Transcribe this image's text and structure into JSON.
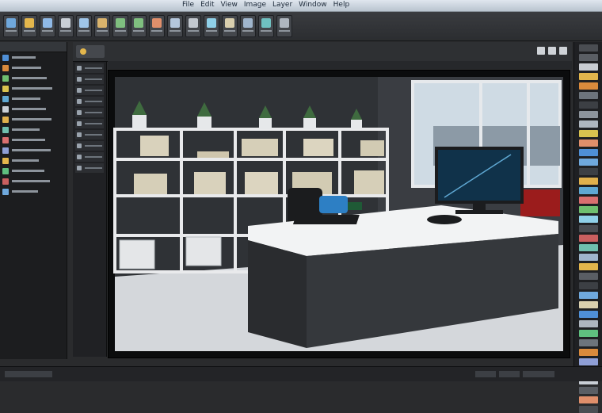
{
  "app": {
    "title_left": "   ",
    "menu_items": [
      "File",
      "Edit",
      "View",
      "Image",
      "Layer",
      "Window",
      "Help"
    ]
  },
  "toolbar": {
    "buttons": [
      {
        "icon": "document-icon",
        "color": "#6fa8dc"
      },
      {
        "icon": "folder-icon",
        "color": "#e3b64c"
      },
      {
        "icon": "save-icon",
        "color": "#8fb9e6"
      },
      {
        "icon": "cut-icon",
        "color": "#c9cfd6"
      },
      {
        "icon": "copy-icon",
        "color": "#9fc5e8"
      },
      {
        "icon": "paste-icon",
        "color": "#d9b36c"
      },
      {
        "icon": "undo-icon",
        "color": "#7fbf7f"
      },
      {
        "icon": "redo-icon",
        "color": "#7fbf7f"
      },
      {
        "icon": "brush-icon",
        "color": "#e08f6b"
      },
      {
        "icon": "select-icon",
        "color": "#b4c7dc"
      },
      {
        "icon": "crop-icon",
        "color": "#c2c8cf"
      },
      {
        "icon": "zoom-icon",
        "color": "#8fd0e8"
      },
      {
        "icon": "hand-icon",
        "color": "#d9cfae"
      },
      {
        "icon": "layers-icon",
        "color": "#9fb5cc"
      },
      {
        "icon": "image-icon",
        "color": "#6fc0c0"
      },
      {
        "icon": "settings-icon",
        "color": "#aeb6bf"
      }
    ]
  },
  "left_panel": {
    "rows": [
      {
        "icon": "image-icon",
        "color": "#4f8fd6"
      },
      {
        "icon": "image-icon",
        "color": "#d98a3c"
      },
      {
        "icon": "image-icon",
        "color": "#6fbf6f"
      },
      {
        "icon": "image-icon",
        "color": "#d9c24f"
      },
      {
        "icon": "image-icon",
        "color": "#5fa8d3"
      },
      {
        "icon": "image-icon",
        "color": "#c9cfd6"
      },
      {
        "icon": "image-icon",
        "color": "#e0b04c"
      },
      {
        "icon": "image-icon",
        "color": "#6fbfae"
      },
      {
        "icon": "image-icon",
        "color": "#d96f6f"
      },
      {
        "icon": "image-icon",
        "color": "#8f9fd6"
      },
      {
        "icon": "image-icon",
        "color": "#e3b64c"
      },
      {
        "icon": "image-icon",
        "color": "#5fbf7f"
      },
      {
        "icon": "image-icon",
        "color": "#c95f5f"
      },
      {
        "icon": "image-icon",
        "color": "#6fa8dc"
      }
    ]
  },
  "right_dock": {
    "swatches": [
      "#4a4d52",
      "#5a5e64",
      "#c8ccd2",
      "#e3b64c",
      "#d98a3c",
      "#6d747c",
      "#3c3f44",
      "#8d949c",
      "#aeb6bf",
      "#d9c24f",
      "#e08f6b",
      "#4f8fd6",
      "#6fa8dc",
      "#3c3f44",
      "#e0b04c",
      "#5fa8d3",
      "#d96f6f",
      "#6fbf6f",
      "#8fd0e8",
      "#4a4d52",
      "#c95f5f",
      "#6fbfae",
      "#9fb5cc",
      "#e3b64c",
      "#5a5e64",
      "#3c3f44",
      "#6fa8dc",
      "#d9cfae",
      "#4f8fd6",
      "#aeb6bf",
      "#5fbf7f",
      "#6d747c",
      "#d98a3c",
      "#8f9fd6",
      "#6fc0c0",
      "#c9cfd6",
      "#5a5e64",
      "#e08f6b",
      "#4a4d52"
    ]
  },
  "canvas": {
    "scene": "office interior render",
    "wall_color": "#2f3236",
    "floor_color": "#d4d7db",
    "desk_top_color": "#f2f3f4",
    "desk_body_color": "#2a2c2f",
    "shelf_color": "#e9eaec",
    "monitor_screen_color": "#10324a",
    "accent_chair_color": "#2d7fc4",
    "accent_red": "#9b1c1c",
    "window_sky": "#cfdbe4"
  }
}
